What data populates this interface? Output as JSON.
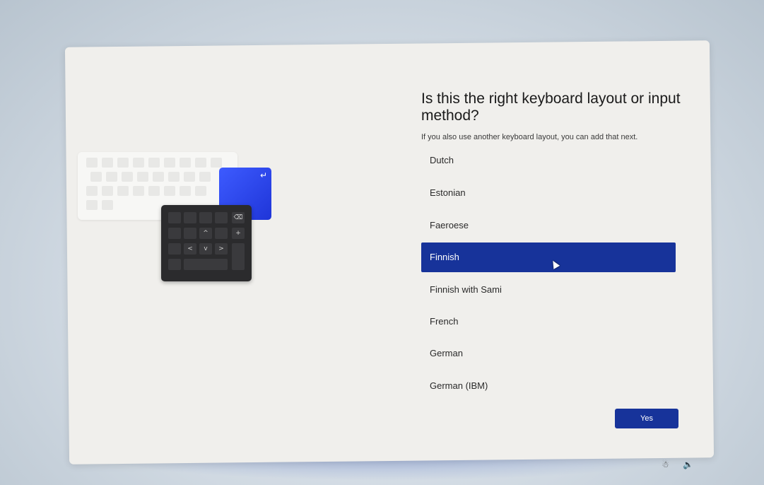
{
  "page": {
    "title": "Is this the right keyboard layout or input method?",
    "subtitle": "If you also use another keyboard layout, you can add that next."
  },
  "layouts": {
    "items": [
      {
        "label": "Dutch",
        "selected": false
      },
      {
        "label": "Estonian",
        "selected": false
      },
      {
        "label": "Faeroese",
        "selected": false
      },
      {
        "label": "Finnish",
        "selected": true
      },
      {
        "label": "Finnish with Sami",
        "selected": false
      },
      {
        "label": "French",
        "selected": false
      },
      {
        "label": "German",
        "selected": false
      },
      {
        "label": "German (IBM)",
        "selected": false
      }
    ]
  },
  "actions": {
    "yes_label": "Yes"
  },
  "illustration": {
    "enter_glyph": "↵",
    "numpad_glyphs": [
      "⌫",
      "^",
      "+",
      "<",
      "v",
      ">"
    ]
  },
  "system_tray": {
    "accessibility_icon": "accessibility-icon",
    "volume_icon": "volume-icon"
  },
  "colors": {
    "accent": "#17339a",
    "selected_text": "#ffffff"
  }
}
